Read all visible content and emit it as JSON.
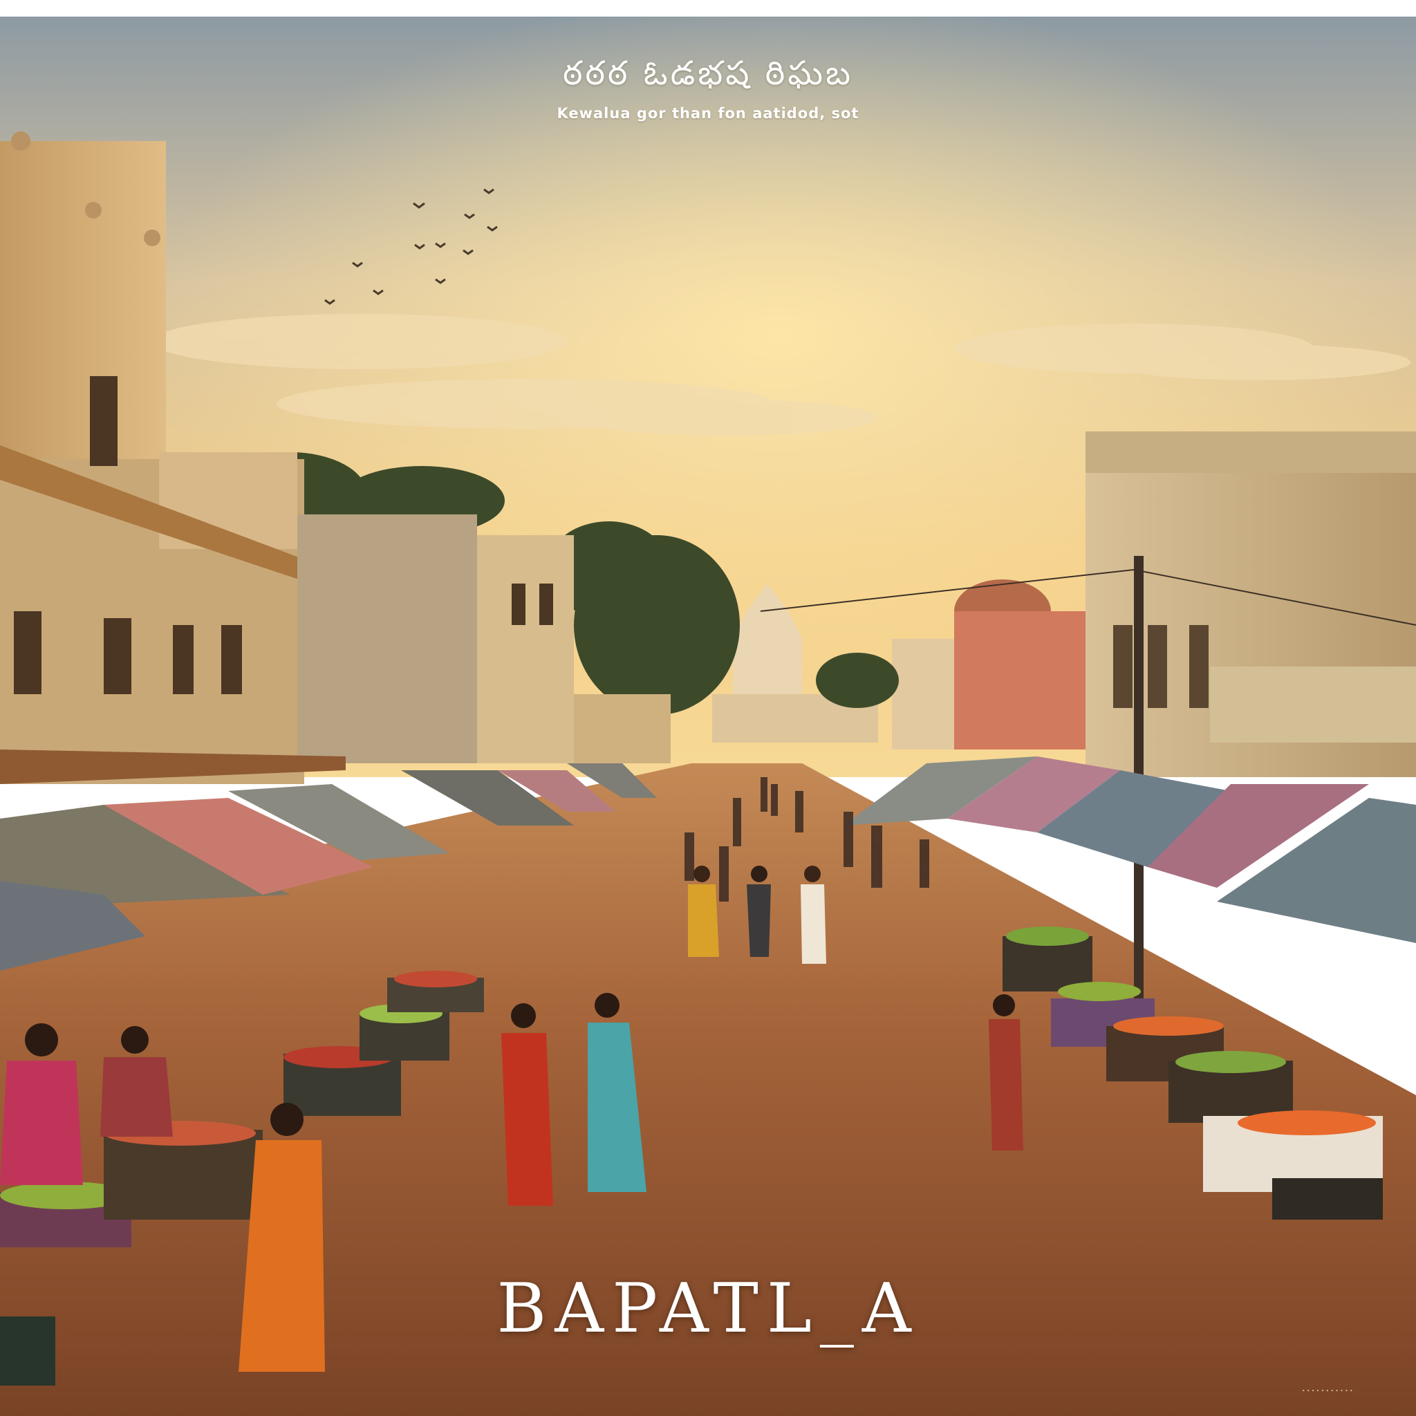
{
  "poster": {
    "script_title": "ఠఠఠ ఓడభష ఠిఘబ",
    "tagline": "Kewalua gor than fon aatidod, sot",
    "town_name": "BAPATL_A",
    "footer_note": "ꞏ ꞏ ꞏ ꞏ ꞏ ꞏ ꞏ ꞏ ꞏ ꞏ ꞏ"
  },
  "colors": {
    "sky_top": "#8d9aa3",
    "sky_glow": "#f3cf8a",
    "street": "#9a5a35",
    "building_left": "#d6b07c",
    "building_right": "#cdb58c",
    "awning_pink": "#c97a6e",
    "awning_slate": "#6f7f8a",
    "text": "#ffffff"
  }
}
